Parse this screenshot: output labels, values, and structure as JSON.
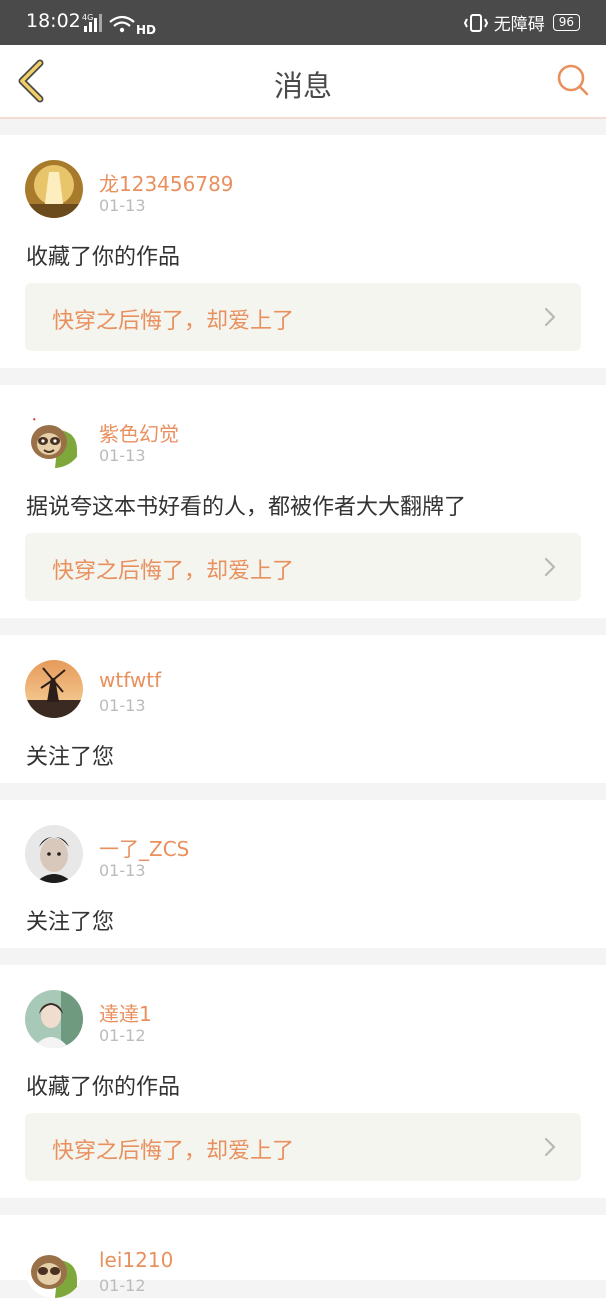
{
  "status_bar": {
    "time": "18:02",
    "network": "4G",
    "hd": "HD",
    "accessibility": "无障碍",
    "battery": "96"
  },
  "header": {
    "title": "消息",
    "accent_color": "#e9905f"
  },
  "messages": [
    {
      "username": "龙123456789",
      "date": "01-13",
      "text": "收藏了你的作品",
      "work_title": "快穿之后悔了，却爱上了"
    },
    {
      "username": "紫色幻觉",
      "date": "01-13",
      "text": "据说夸这本书好看的人，都被作者大大翻牌了",
      "work_title": "快穿之后悔了，却爱上了"
    },
    {
      "username": "wtfwtf",
      "date": "01-13",
      "text": "关注了您"
    },
    {
      "username": "一了_ZCS",
      "date": "01-13",
      "text": "关注了您"
    },
    {
      "username": "達達1",
      "date": "01-12",
      "text": "收藏了你的作品",
      "work_title": "快穿之后悔了，却爱上了"
    },
    {
      "username": "lei1210",
      "date": "01-12"
    }
  ]
}
